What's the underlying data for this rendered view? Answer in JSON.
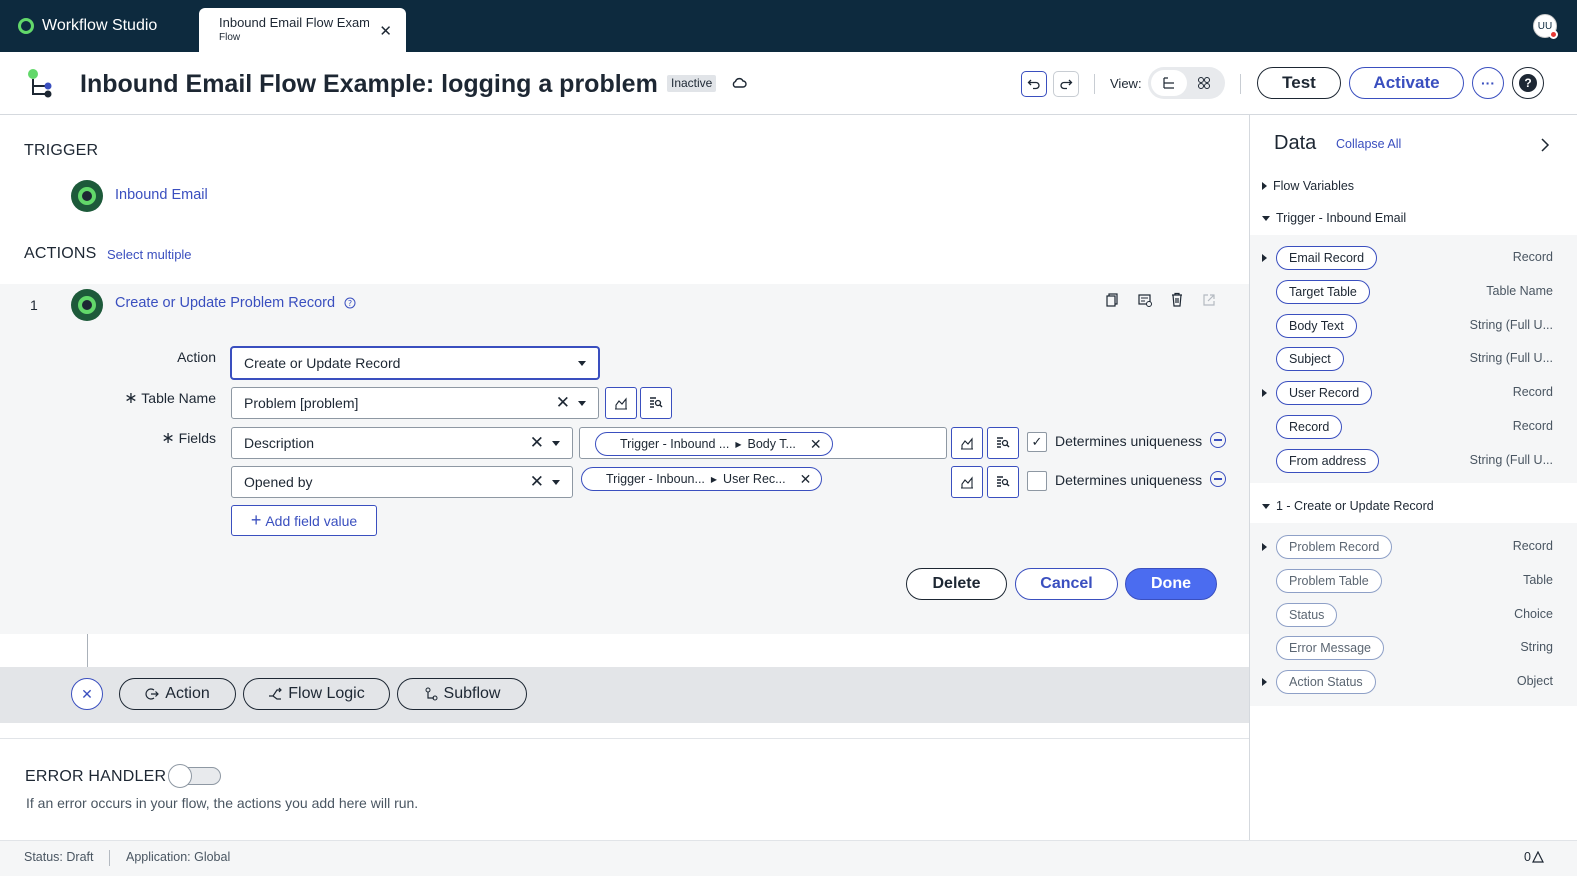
{
  "app": {
    "name": "Workflow Studio"
  },
  "tab": {
    "title": "Inbound Email Flow Example: logging a problem",
    "subtitle": "Flow"
  },
  "user": {
    "initials": "UU"
  },
  "header": {
    "title": "Inbound Email Flow Example: logging a problem",
    "status_badge": "Inactive",
    "view_label": "View:",
    "test_label": "Test",
    "activate_label": "Activate",
    "more_label": "···",
    "help_label": "?"
  },
  "trigger": {
    "section_title": "TRIGGER",
    "name": "Inbound Email"
  },
  "actions": {
    "section_title": "ACTIONS",
    "select_multiple": "Select multiple",
    "items": [
      {
        "index": "1",
        "name": "Create or Update Problem Record",
        "action_label": "Action",
        "action_value": "Create or Update Record",
        "table_label": "Table Name",
        "table_value": "Problem [problem]",
        "fields_label": "Fields",
        "fields": [
          {
            "field": "Description",
            "pill_a": "Trigger - Inbound ...",
            "pill_b": "Body T...",
            "unique_label": "Determines uniqueness",
            "unique_checked": true
          },
          {
            "field": "Opened by",
            "pill_a": "Trigger - Inboun...",
            "pill_b": "User Rec...",
            "unique_label": "Determines uniqueness",
            "unique_checked": false
          }
        ],
        "add_field_label": "Add field value",
        "delete_label": "Delete",
        "cancel_label": "Cancel",
        "done_label": "Done"
      }
    ]
  },
  "add_bar": {
    "action_label": "Action",
    "flow_logic_label": "Flow Logic",
    "subflow_label": "Subflow"
  },
  "error_handler": {
    "title": "ERROR HANDLER",
    "description": "If an error occurs in your flow, the actions you add here will run.",
    "enabled": false
  },
  "statusbar": {
    "status": "Status: Draft",
    "application": "Application: Global",
    "count": "0"
  },
  "data_panel": {
    "title": "Data",
    "collapse_all": "Collapse All",
    "flow_variables": "Flow Variables",
    "trigger_group": "Trigger - Inbound Email",
    "trigger_items": [
      {
        "label": "Email Record",
        "type": "Record",
        "expandable": true
      },
      {
        "label": "Target Table",
        "type": "Table Name",
        "expandable": false
      },
      {
        "label": "Body Text",
        "type": "String (Full U...",
        "expandable": false
      },
      {
        "label": "Subject",
        "type": "String (Full U...",
        "expandable": false
      },
      {
        "label": "User Record",
        "type": "Record",
        "expandable": true
      },
      {
        "label": "Record",
        "type": "Record",
        "expandable": false
      },
      {
        "label": "From address",
        "type": "String (Full U...",
        "expandable": false
      }
    ],
    "action_group": "1 - Create or Update Record",
    "action_items": [
      {
        "label": "Problem Record",
        "type": "Record",
        "expandable": true
      },
      {
        "label": "Problem Table",
        "type": "Table",
        "expandable": false
      },
      {
        "label": "Status",
        "type": "Choice",
        "expandable": false
      },
      {
        "label": "Error Message",
        "type": "String",
        "expandable": false
      },
      {
        "label": "Action Status",
        "type": "Object",
        "expandable": true
      }
    ]
  },
  "colors": {
    "topbar": "#0d2a3e",
    "accent": "#3a4fbf",
    "brand_green": "#62d86a",
    "done": "#4b6cf0"
  }
}
